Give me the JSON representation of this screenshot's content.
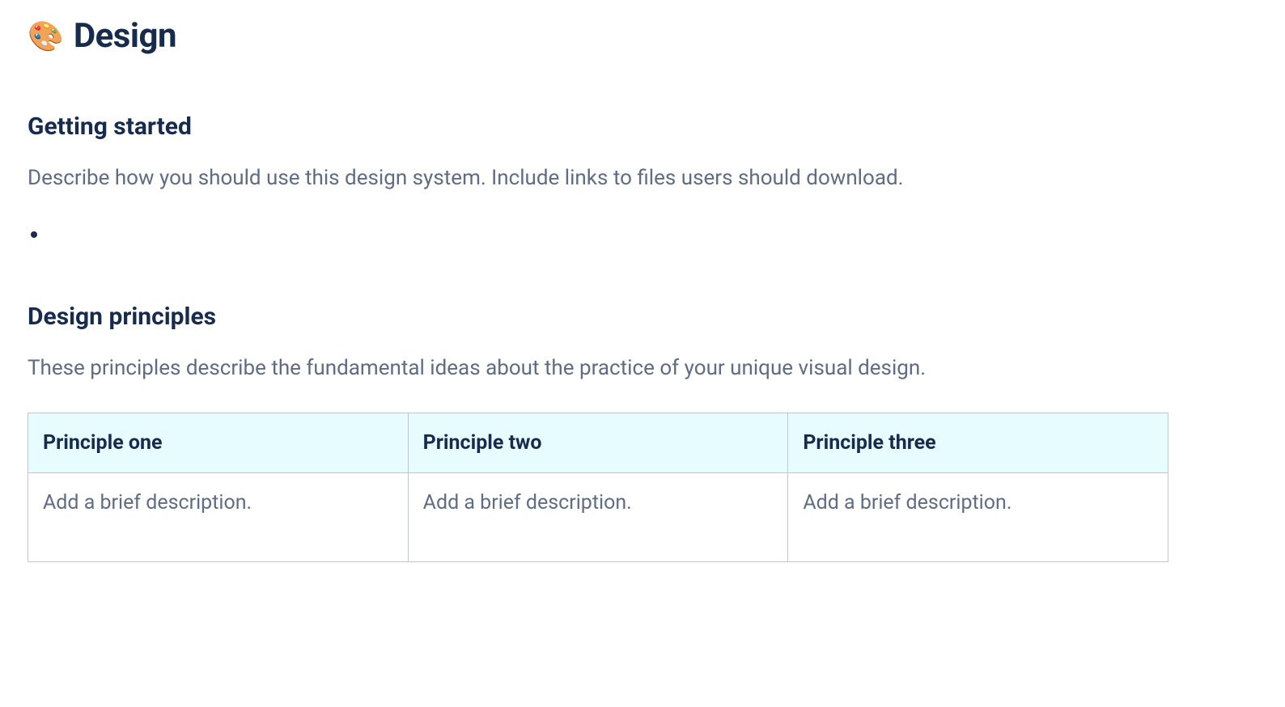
{
  "page": {
    "icon": "🎨",
    "title": "Design"
  },
  "sections": {
    "getting_started": {
      "heading": "Getting started",
      "description": "Describe how you should use this design system. Include links to files users should download.",
      "bullets": [
        ""
      ]
    },
    "design_principles": {
      "heading": "Design principles",
      "description": "These principles describe the fundamental ideas about the practice of your unique visual design.",
      "table": {
        "headers": [
          "Principle one",
          "Principle two",
          "Principle three"
        ],
        "cells": [
          "Add a brief description.",
          "Add a brief description.",
          "Add a brief description."
        ]
      }
    }
  }
}
